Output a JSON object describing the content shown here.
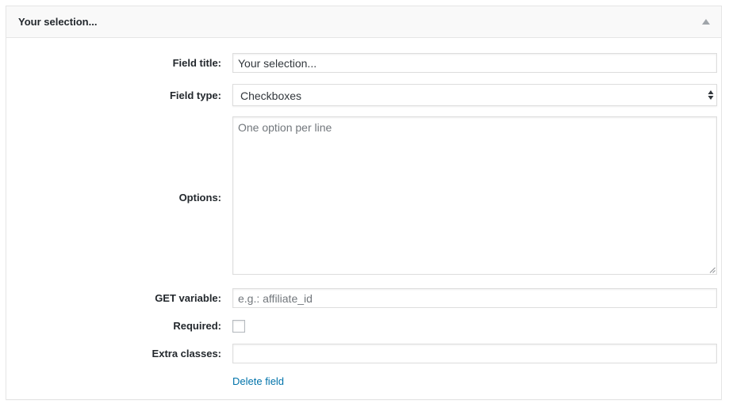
{
  "panel": {
    "title": "Your selection...",
    "toggle_icon": "collapse-arrow-up-icon"
  },
  "form": {
    "field_title": {
      "label": "Field title:",
      "value": "Your selection..."
    },
    "field_type": {
      "label": "Field type:",
      "selected": "Checkboxes",
      "icon": "select-updown-arrows-icon"
    },
    "options": {
      "label": "Options:",
      "value": "",
      "placeholder": "One option per line"
    },
    "get_variable": {
      "label": "GET variable:",
      "value": "",
      "placeholder": "e.g.: affiliate_id"
    },
    "required": {
      "label": "Required:",
      "checked": false
    },
    "extra_classes": {
      "label": "Extra classes:",
      "value": ""
    },
    "delete_link": "Delete field"
  },
  "colors": {
    "link": "#0073aa",
    "border": "#dddddd",
    "header_bg": "#f9f9f9",
    "text": "#23282d",
    "placeholder": "#72777c"
  }
}
